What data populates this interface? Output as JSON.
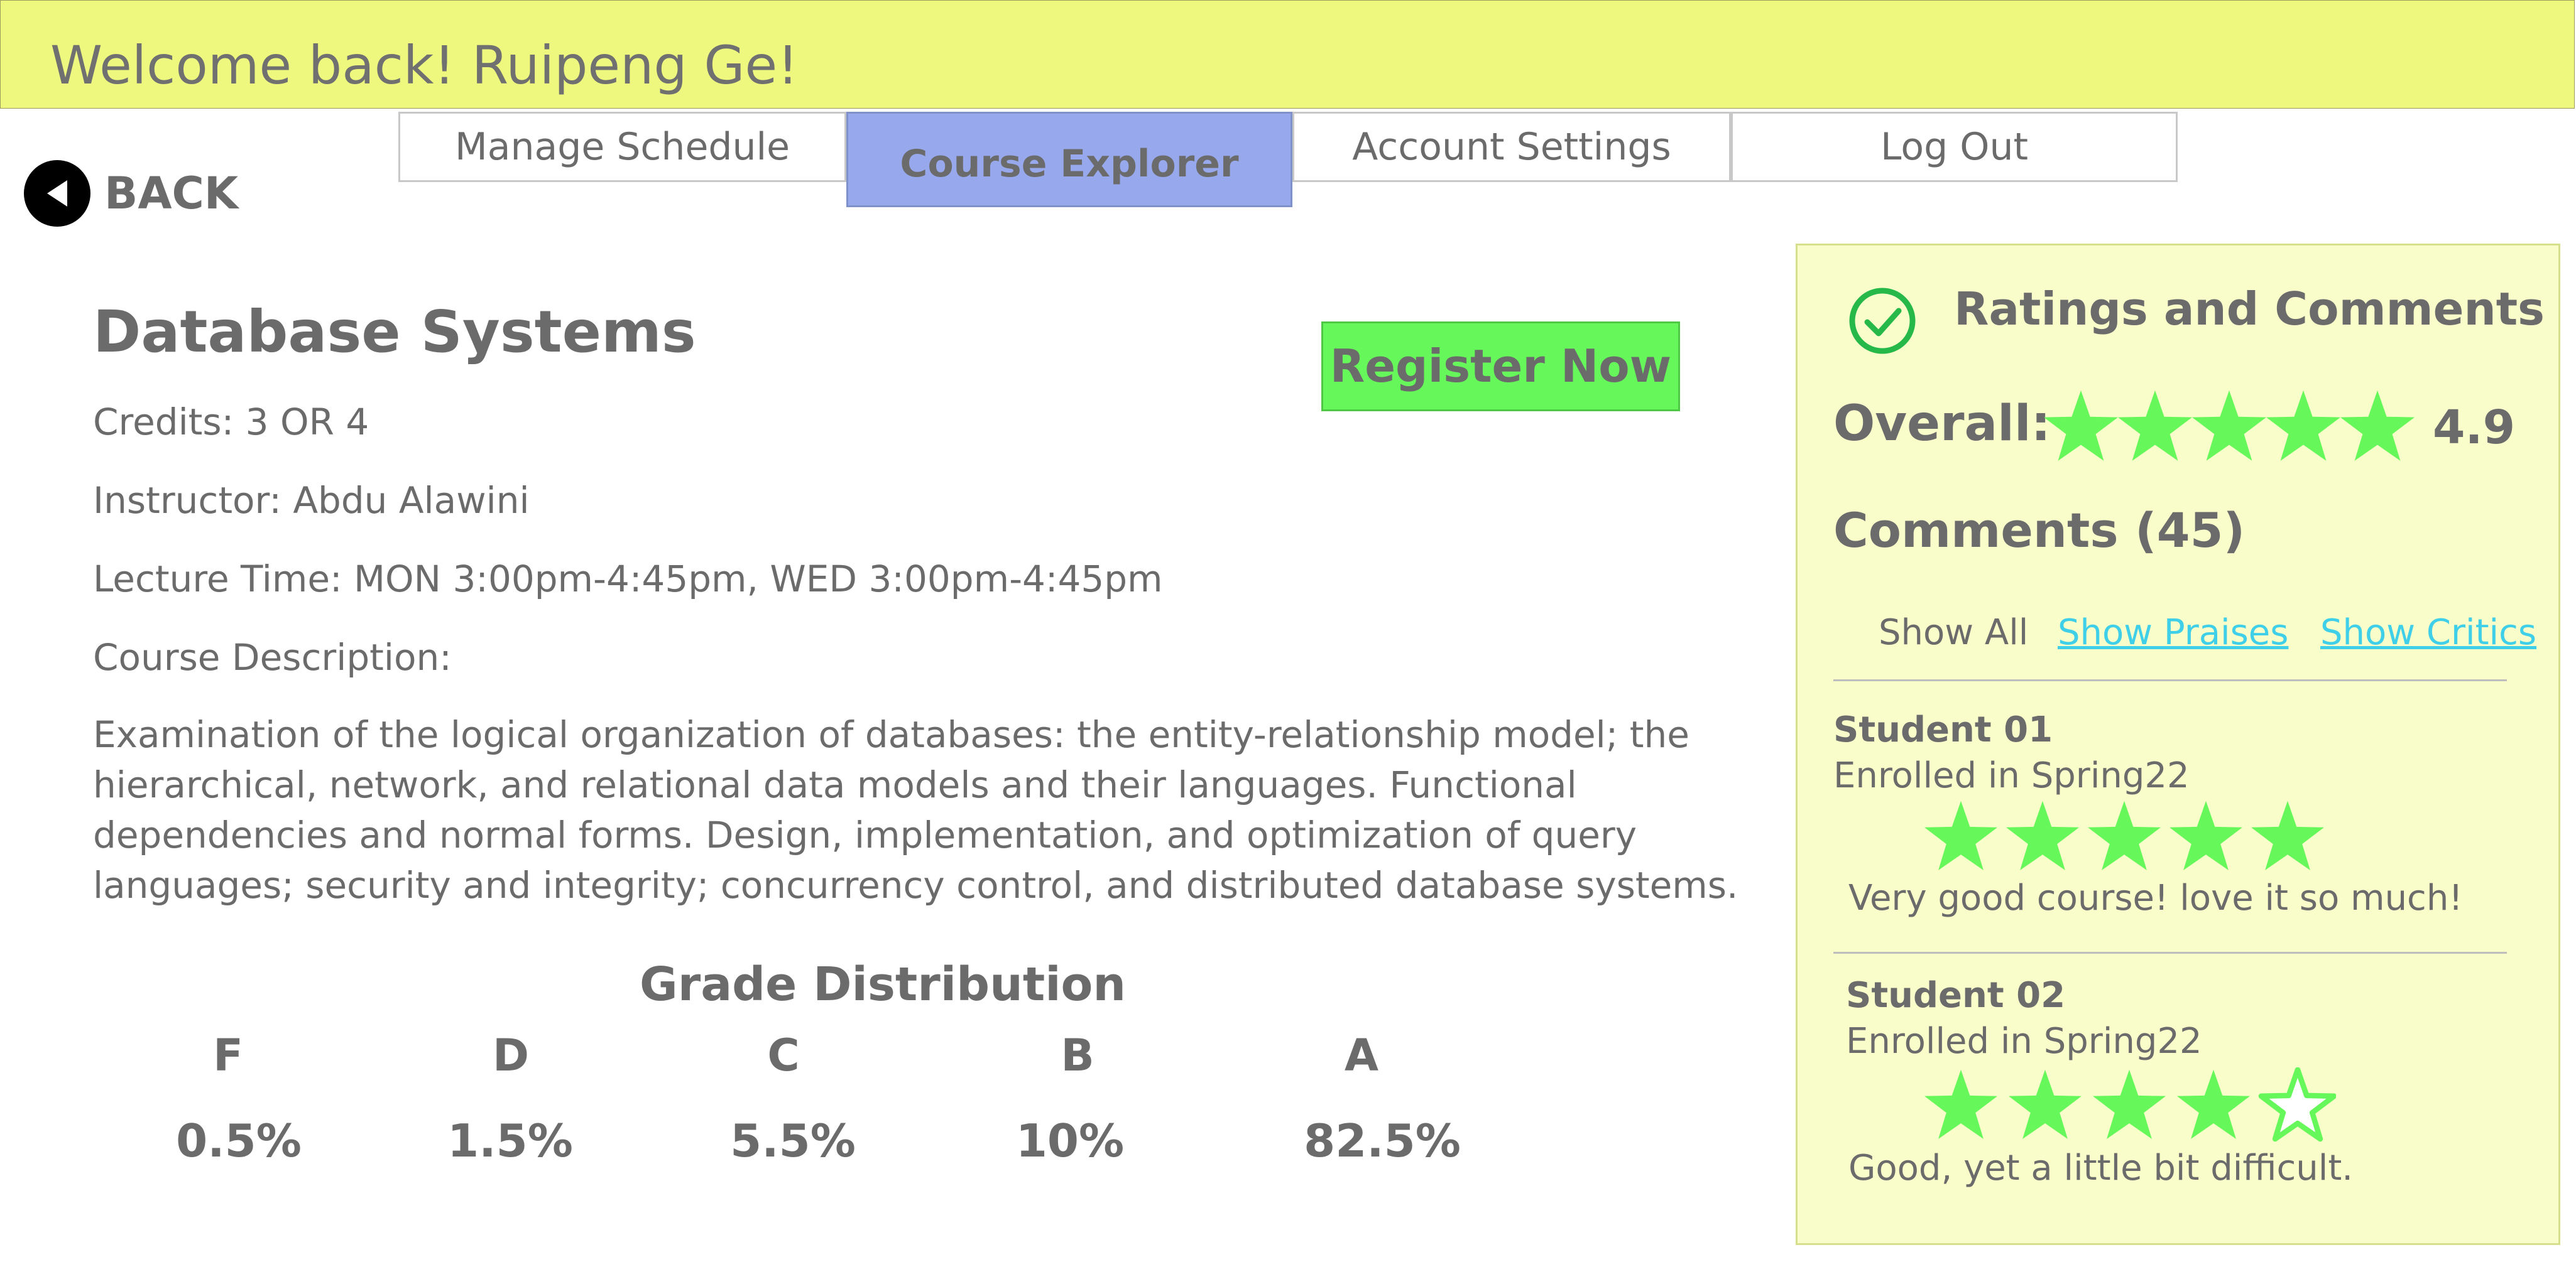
{
  "header": {
    "welcome": "Welcome back! Ruipeng Ge!"
  },
  "nav": {
    "tabs": [
      {
        "label": "Manage Schedule",
        "active": false
      },
      {
        "label": "Course Explorer",
        "active": true
      },
      {
        "label": "Account Settings",
        "active": false
      },
      {
        "label": "Log Out",
        "active": false
      }
    ]
  },
  "back": {
    "label": "BACK",
    "icon": "back-arrow-icon"
  },
  "course": {
    "title": "Database Systems",
    "credits": "Credits: 3 OR 4",
    "instructor": "Instructor: Abdu Alawini",
    "lecture_time": "Lecture Time: MON 3:00pm-4:45pm, WED 3:00pm-4:45pm",
    "description_label": "Course Description:",
    "description": "Examination of the logical organization of databases: the entity-relationship model; the hierarchical, network, and relational data models and their languages. Functional dependencies and normal forms. Design, implementation, and optimization of query languages; security and integrity; concurrency control, and distributed database systems.",
    "register_label": "Register Now"
  },
  "grades": {
    "title": "Grade Distribution",
    "items": [
      {
        "letter": "F",
        "percent": "0.5%"
      },
      {
        "letter": "D",
        "percent": "1.5%"
      },
      {
        "letter": "C",
        "percent": "5.5%"
      },
      {
        "letter": "B",
        "percent": "10%"
      },
      {
        "letter": "A",
        "percent": "82.5%"
      }
    ]
  },
  "ratings": {
    "title": "Ratings and Comments",
    "overall_label": "Overall:",
    "overall_value": "4.9",
    "overall_stars": 5,
    "comments_title": "Comments (45)",
    "filters": {
      "all": "Show All",
      "praises": "Show Praises",
      "critics": "Show Critics"
    },
    "comments": [
      {
        "name": "Student 01",
        "term": "Enrolled in Spring22",
        "stars": 5,
        "text": "Very good course! love it so much!"
      },
      {
        "name": "Student 02",
        "term": "Enrolled in Spring22",
        "stars": 4,
        "text": "Good, yet a little bit difficult."
      }
    ]
  },
  "colors": {
    "header_bg": "#eef87e",
    "active_tab": "#97a9ec",
    "register_bg": "#66f75a",
    "panel_bg": "#f8fdc9",
    "star": "#66f75a",
    "link": "#3fcfe8",
    "check": "#27b84a"
  }
}
